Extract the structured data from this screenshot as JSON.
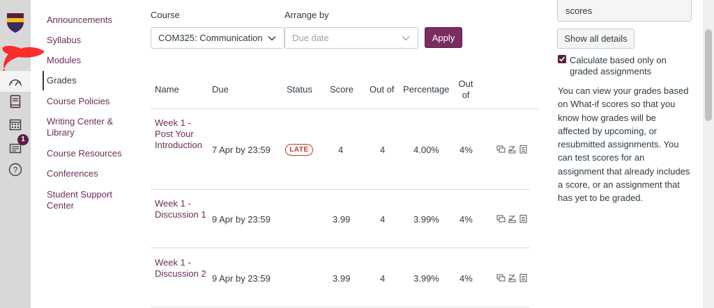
{
  "nav_rail": {
    "items": [
      {
        "icon": "speedometer-icon",
        "active": true
      },
      {
        "icon": "book-icon"
      },
      {
        "icon": "calendar-icon"
      },
      {
        "icon": "inbox-icon",
        "badge": "1"
      },
      {
        "icon": "help-icon"
      }
    ],
    "accent_color": "#5a1e43"
  },
  "course_nav": {
    "items": [
      {
        "label": "Announcements"
      },
      {
        "label": "Syllabus"
      },
      {
        "label": "Modules"
      },
      {
        "label": "Grades",
        "active": true
      },
      {
        "label": "Course Policies"
      },
      {
        "label": "Writing Center & Library"
      },
      {
        "label": "Course Resources"
      },
      {
        "label": "Conferences"
      },
      {
        "label": "Student Support Center"
      }
    ]
  },
  "filters": {
    "course_label": "Course",
    "course_value": "COM325: Communication",
    "arrange_label": "Arrange by",
    "arrange_placeholder": "Due date",
    "apply_label": "Apply"
  },
  "table": {
    "headers": {
      "name": "Name",
      "due": "Due",
      "status": "Status",
      "score": "Score",
      "out_of": "Out of",
      "percentage": "Percentage",
      "out_of_2": "Out of"
    },
    "rows": [
      {
        "name": "Week 1 - Post Your Introduction",
        "due": "7 Apr by 23:59",
        "status": "LATE",
        "score": "4",
        "out_of": "4",
        "percentage": "4.00%",
        "weight": "4%"
      },
      {
        "name": "Week 1 - Discussion 1",
        "due": "9 Apr by 23:59",
        "status": "",
        "score": "3.99",
        "out_of": "4",
        "percentage": "3.99%",
        "weight": "4%"
      },
      {
        "name": "Week 1 - Discussion 2",
        "due": "9 Apr by 23:59",
        "status": "",
        "score": "3.99",
        "out_of": "4",
        "percentage": "3.99%",
        "weight": "4%"
      }
    ]
  },
  "sidebar": {
    "scores_text": "scores",
    "show_all_label": "Show all details",
    "checkbox_label": "Calculate based only on graded assignments",
    "checkbox_checked": true,
    "help_text": "You can view your grades based on What-if scores so that you know how grades will be affected by upcoming, or resubmitted assignments. You can test scores for an assignment that already includes a score, or an assignment that has yet to be graded."
  },
  "colors": {
    "brand": "#7b2d5f",
    "link": "#6b2d55",
    "late": "#c0392b"
  }
}
